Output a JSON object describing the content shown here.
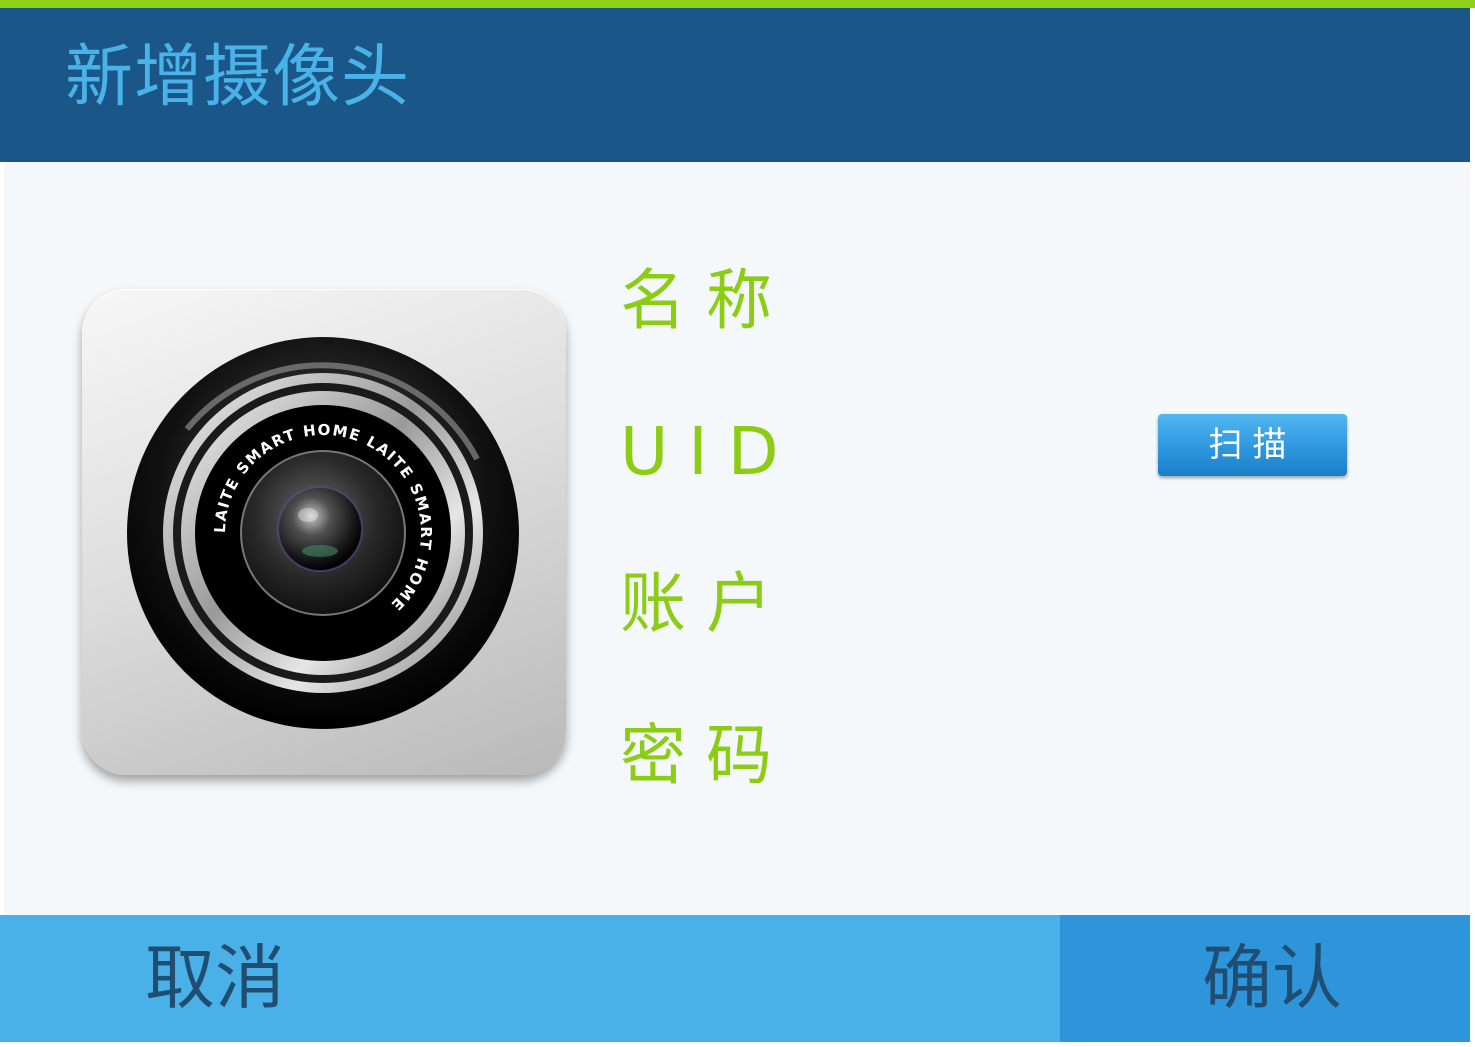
{
  "header": {
    "title": "新增摄像头"
  },
  "camera_icon": {
    "name": "camera-lens-icon",
    "ring_text": "LAITE SMART HOME  LAITE SMART HOME  "
  },
  "form": {
    "name_label": "名称",
    "uid_label": "UID",
    "account_label": "账户",
    "password_label": "密码",
    "scan_button": "扫描"
  },
  "footer": {
    "cancel_label": "取消",
    "confirm_label": "确认"
  },
  "colors": {
    "accent_green": "#8fd11a",
    "header_bg": "#1b5688",
    "title_blue": "#49b2e8",
    "label_green": "#8ccc14",
    "footer_cancel": "#49b1e7",
    "footer_confirm": "#2f95da"
  }
}
